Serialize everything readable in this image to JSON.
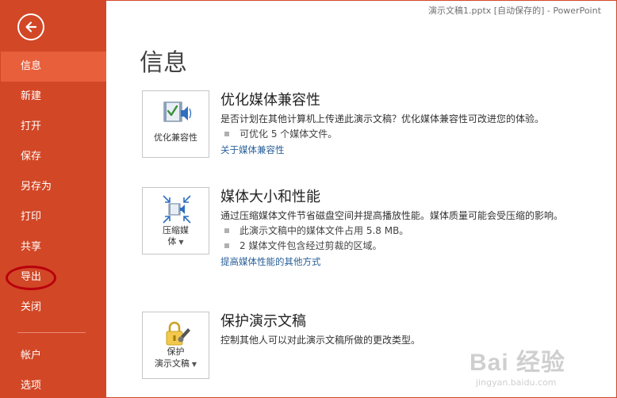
{
  "window": {
    "title": "演示文稿1.pptx [自动保存的] - PowerPoint"
  },
  "sidebar": {
    "items": [
      {
        "label": "信息",
        "active": true
      },
      {
        "label": "新建"
      },
      {
        "label": "打开"
      },
      {
        "label": "保存"
      },
      {
        "label": "另存为"
      },
      {
        "label": "打印"
      },
      {
        "label": "共享"
      },
      {
        "label": "导出",
        "highlighted": true
      },
      {
        "label": "关闭"
      }
    ],
    "bottom_items": [
      {
        "label": "帐户"
      },
      {
        "label": "选项"
      }
    ]
  },
  "main": {
    "title": "信息",
    "sections": [
      {
        "icon": "media-compatibility-icon",
        "button_label": "优化兼容性",
        "title": "优化媒体兼容性",
        "description": "是否计划在其他计算机上传递此演示文稿？优化媒体兼容性可改进您的体验。",
        "bullets": [
          "可优化 5 个媒体文件。"
        ],
        "link": "关于媒体兼容性"
      },
      {
        "icon": "compress-media-icon",
        "button_label_line1": "压缩媒",
        "button_label_line2": "体",
        "title": "媒体大小和性能",
        "description": "通过压缩媒体文件节省磁盘空间并提高播放性能。媒体质量可能会受压缩的影响。",
        "bullets": [
          "此演示文稿中的媒体文件占用 5.8 MB。",
          "2 媒体文件包含经过剪裁的区域。"
        ],
        "link": "提高媒体性能的其他方式"
      },
      {
        "icon": "protect-presentation-icon",
        "button_label_line1": "保护",
        "button_label_line2": "演示文稿",
        "title": "保护演示文稿",
        "description": "控制其他人可以对此演示文稿所做的更改类型。"
      }
    ]
  },
  "watermark": {
    "main": "Bai 经验",
    "sub": "jingyan.baidu.com"
  },
  "colors": {
    "accent": "#d24726",
    "active_item": "#e85f3c",
    "link": "#2a6099",
    "highlight_ring": "#b8000c"
  }
}
